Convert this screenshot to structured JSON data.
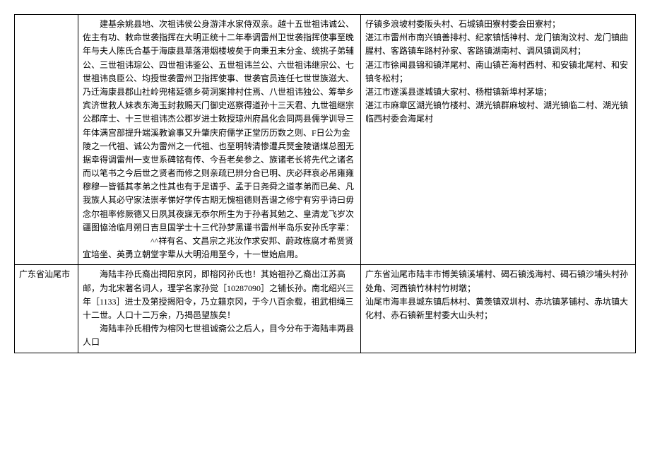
{
  "row1": {
    "region": "",
    "desc_p1": "建基余姚县地、次祖讳侯公身游沣水家侍双亲。越十五世祖讳诚公、佐主有功、敕命世袭指挥在大明正统十二年奉调雷州卫世袭指挥使事至晚年与夫人陈氏合基于海康县草落港烟楼坡矣于向秉丑末分金、统挑子弟辅公、三世祖讳琮公、四世祖讳鉴公、五世祖讳兰公、六世祖讳继宗公、七世祖讳良臣公、均授世袭雷州卫指挥使事、世袭官员连任七世世族滋大、乃迁海康县郡山社岭兜楮延德乡荷洞案排村住焉、八世祖讳独公、筹举乡宾济世救人妹表东海玉封救赐天门御史巡察得道孙十三天君、九世祖继宗公郡庠士、十三世祖讳杰公郡岁进士敕授琼州府昌化会同两县儒学训导三年体满宫部提升端溪教谕事又升肇庆府儒学正堂历历数之则、F日公为金陵之一代祖、诚公为雷州之一代祖、也至明转清惨遭兵燹金陵谱煤总图无据幸得调雷州一支世系碑铭有传、今吾老矣参之、族诸老长将先代之诸名而以笔书之今后世之贤者而修之则亲疏已辨分合已明、庆必拜哀必吊雍雍穆穆一皆循其孝弟之性其也有于足谱乎、孟于日尧舜之道孝弟而已矣、凡我族人其必守家法崇孝悌好学传古期无愧祖德则吾谱之修宁有穷乎诗曰毋念尔祖率修厥德又日夙其夜寐无忝尔所生为于孙者其勉之、皇清龙飞岁次疆图恊洽临月朔日吉旦国学士十三代孙梦黑谨书雷州半岛乐安孙氏字辈：",
    "desc_poem": "^^祥有名、文昌宗之兆汝作求安邦、蔚政栋腐才希贤贤",
    "desc_p2": "宜培坐、英勇立朝堂字辈从大明沿用至今，十一世始启用。",
    "villages_p1": "仔镇多浪坡村委阪头村、石城镇田寮村委会田寮村；",
    "villages_p2": "湛江市雷州市南兴镇善排村、纪家镇恬神村、龙门镇淘汶村、龙门镇曲腥村、客路镇车路村孙家、客路镇湖南村、调风镇调风村；",
    "villages_p3": "湛江市徐闻县锦和镇洋尾村、南山镇芒海村西村、和安镇北尾村、和安镇冬松村；",
    "villages_p4": "湛江市遂溪县遂城镇大家村、杨柑镇新埠村茅塘；",
    "villages_p5": "湛江市麻章区湖光镇竹楼村、湖光镇群麻坡村、湖光镇临二村、湖光镇临西村委会海尾村"
  },
  "row2": {
    "region": "广东省汕尾市",
    "desc_p1": "海陆丰孙氏裔出揭阳京冈，即榕冈孙氏也！其始祖孙乙裔出江苏高邮，为北宋著名词人，理学名家孙觉［10287090］之铺长孙。南北绍兴三年［1133］进士及第授揭阳令，乃立籍京冈，于今八百余载，祖武相绳三十二世。人口十二万余，乃揭邑望族矣！",
    "desc_p2": "海陆丰孙氏相传为榕冈七世祖诚斋公之后人，目今分布于海陆丰两县人口",
    "villages_p1": "广东省汕尾市陆丰市博美镇溪埔村、碣石镇浅海村、碣石镇沙埔头村孙处角、河西镇竹林村竹树墩；",
    "villages_p2": "汕尾市海丰县城东镇后林村、黄羡镇双圳村、赤坑镇茅铺村、赤坑镇大化村、赤石镇新里村委大山头村；"
  }
}
